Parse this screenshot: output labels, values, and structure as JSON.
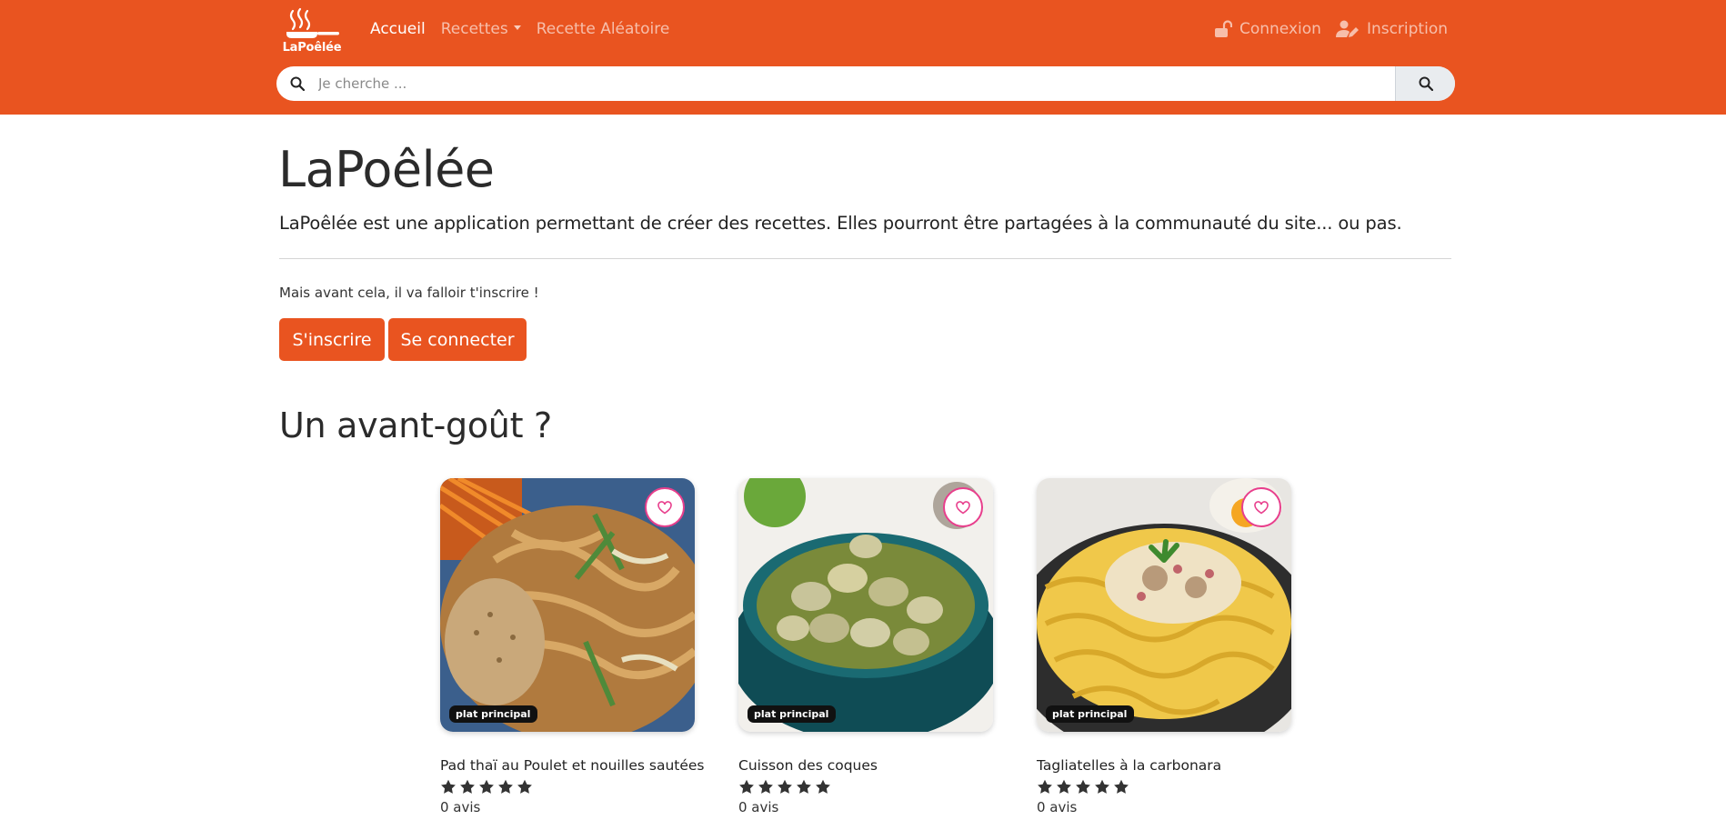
{
  "colors": {
    "primary": "#e95420",
    "favorite": "#e83e8c",
    "text": "#2b2b2b"
  },
  "navbar": {
    "brand": "LaPoêlée",
    "links": [
      {
        "label": "Accueil",
        "active": true
      },
      {
        "label": "Recettes",
        "dropdown": true
      },
      {
        "label": "Recette Aléatoire"
      }
    ],
    "right": [
      {
        "label": "Connexion",
        "icon": "unlock-icon"
      },
      {
        "label": "Inscription",
        "icon": "user-edit-icon"
      }
    ]
  },
  "search": {
    "placeholder": "Je cherche ...",
    "value": ""
  },
  "hero": {
    "title": "LaPoêlée",
    "lead": "LaPoêlée est une application permettant de créer des recettes. Elles pourront être partagées à la communauté du site... ou pas.",
    "subtext": "Mais avant cela, il va falloir t'inscrire !",
    "signup_label": "S'inscrire",
    "login_label": "Se connecter"
  },
  "preview": {
    "title": "Un avant-goût ?",
    "recipes": [
      {
        "title": "Pad thaï au Poulet et nouilles sautées",
        "category": "plat principal",
        "rating": 5,
        "reviews": "0 avis"
      },
      {
        "title": "Cuisson des coques",
        "category": "plat principal",
        "rating": 5,
        "reviews": "0 avis"
      },
      {
        "title": "Tagliatelles à la carbonara",
        "category": "plat principal",
        "rating": 5,
        "reviews": "0 avis"
      }
    ]
  }
}
